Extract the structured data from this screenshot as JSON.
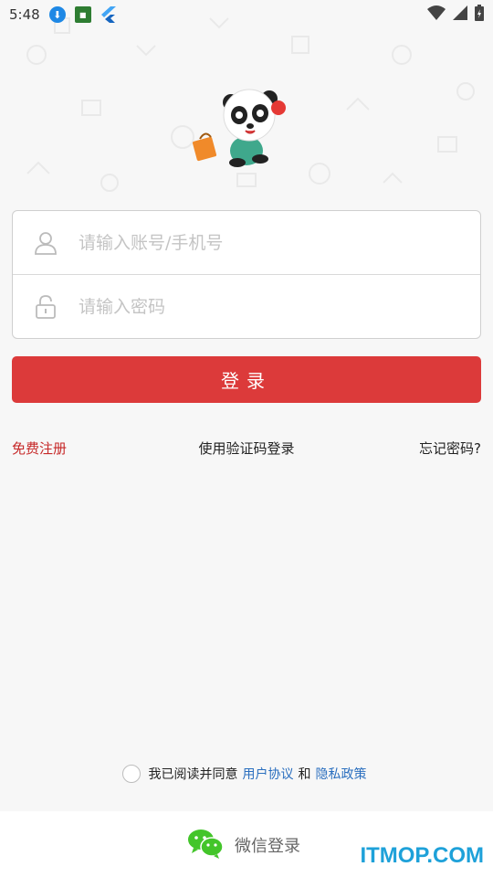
{
  "status_bar": {
    "time": "5:48",
    "left_icons": [
      "download-icon",
      "app-notification-icon",
      "flutter-icon"
    ],
    "right_icons": [
      "wifi-icon",
      "signal-icon",
      "battery-icon"
    ]
  },
  "login_form": {
    "account_placeholder": "请输入账号/手机号",
    "password_placeholder": "请输入密码",
    "account_icon": "user-icon",
    "password_icon": "lock-icon"
  },
  "login_button": {
    "label": "登录"
  },
  "links": {
    "register": "免费注册",
    "code_login": "使用验证码登录",
    "forgot_password": "忘记密码?"
  },
  "agreement": {
    "prefix": "我已阅读并同意",
    "user_agreement": "用户协议",
    "and": "和",
    "privacy_policy": "隐私政策"
  },
  "wechat_login": {
    "label": "微信登录",
    "icon": "wechat-icon"
  },
  "watermark": {
    "text": "ITMOP.COM"
  },
  "colors": {
    "primary": "#dc3a3a",
    "link_blue": "#2b6fbf",
    "register_red": "#c62828",
    "background": "#f7f7f7",
    "wechat_green": "#43c52a"
  }
}
